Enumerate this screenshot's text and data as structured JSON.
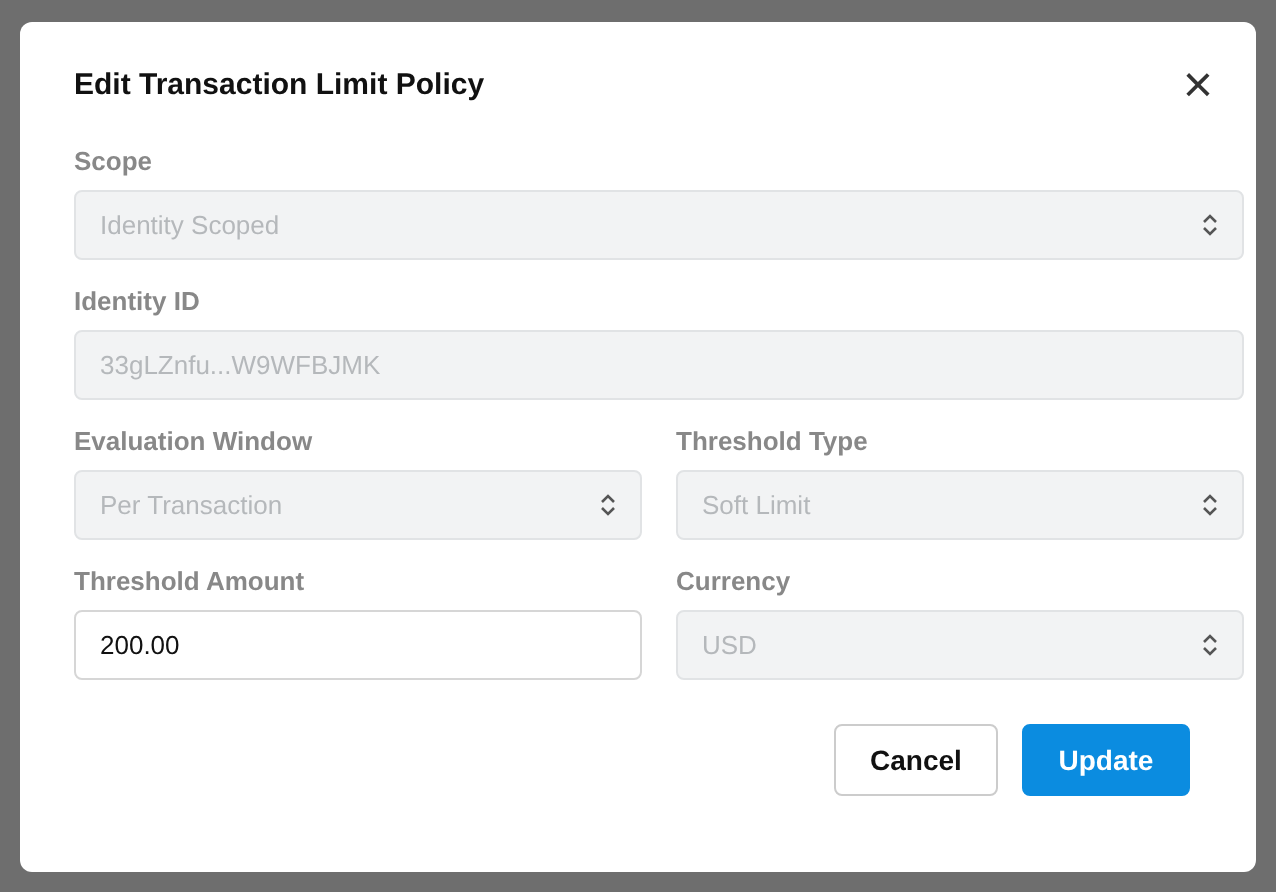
{
  "dialog": {
    "title": "Edit Transaction Limit Policy",
    "close": "×",
    "rows": [
      [
        {
          "label": "Scope",
          "kind": "select",
          "value": "Identity Scoped",
          "disabled": true
        }
      ],
      [
        {
          "label": "Identity ID",
          "kind": "text",
          "value": "33gLZnfu...W9WFBJMK",
          "disabled": true
        }
      ],
      [
        {
          "label": "Evaluation Window",
          "kind": "select",
          "value": "Per Transaction",
          "disabled": true
        },
        {
          "label": "Threshold Type",
          "kind": "select",
          "value": "Soft Limit",
          "disabled": true
        }
      ],
      [
        {
          "label": "Threshold Amount",
          "kind": "text",
          "value": "200.00",
          "disabled": false
        },
        {
          "label": "Currency",
          "kind": "select",
          "value": "USD",
          "disabled": true
        }
      ]
    ],
    "buttons": [
      {
        "label": "Cancel",
        "kind": "secondary"
      },
      {
        "label": "Update",
        "kind": "primary"
      }
    ]
  }
}
